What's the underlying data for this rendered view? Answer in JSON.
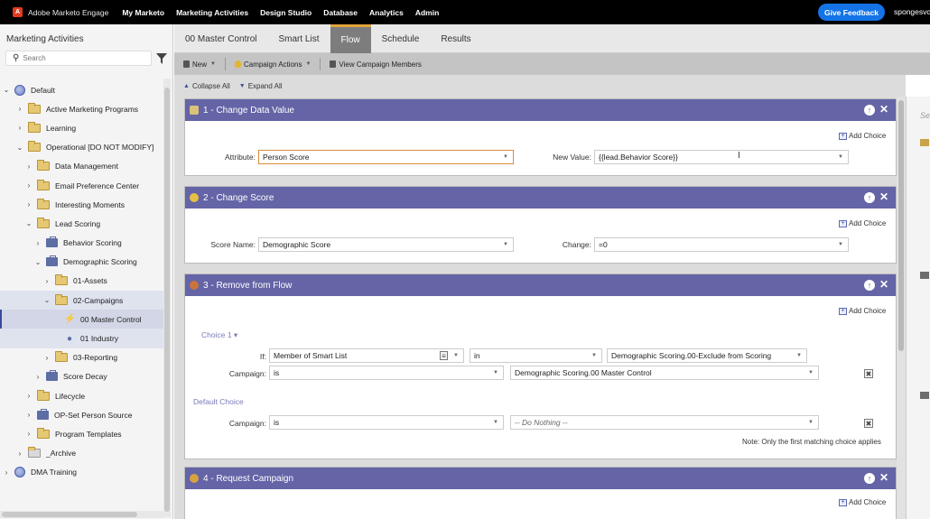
{
  "topnav": {
    "brand": "Adobe Marketo Engage",
    "items": [
      "My Marketo",
      "Marketing Activities",
      "Design Studio",
      "Database",
      "Analytics",
      "Admin"
    ],
    "feedback": "Give Feedback",
    "user": "spongesvc"
  },
  "leftpanel": {
    "title": "Marketing Activities",
    "search_placeholder": "Search",
    "tree": [
      {
        "label": "Default",
        "icon": "globe-icon",
        "chevron": "down",
        "depth": 0
      },
      {
        "label": "Active Marketing Programs",
        "icon": "folder-icon",
        "chevron": "right",
        "depth": 1
      },
      {
        "label": "Learning",
        "icon": "folder-icon",
        "chevron": "right",
        "depth": 1
      },
      {
        "label": "Operational [DO NOT MODIFY]",
        "icon": "folder-icon",
        "chevron": "down",
        "depth": 1
      },
      {
        "label": "Data Management",
        "icon": "folder-icon",
        "chevron": "right",
        "depth": 2
      },
      {
        "label": "Email Preference Center",
        "icon": "folder-icon",
        "chevron": "right",
        "depth": 2
      },
      {
        "label": "Interesting Moments",
        "icon": "folder-icon",
        "chevron": "right",
        "depth": 2
      },
      {
        "label": "Lead Scoring",
        "icon": "folder-icon",
        "chevron": "down",
        "depth": 2
      },
      {
        "label": "Behavior Scoring",
        "icon": "program-icon",
        "chevron": "right",
        "depth": 3
      },
      {
        "label": "Demographic Scoring",
        "icon": "program-icon",
        "chevron": "down",
        "depth": 3
      },
      {
        "label": "01-Assets",
        "icon": "folder-icon",
        "chevron": "right",
        "depth": 4
      },
      {
        "label": "02-Campaigns",
        "icon": "folder-icon",
        "chevron": "down",
        "depth": 4
      },
      {
        "label": "00 Master Control",
        "icon": "trigger-icon",
        "chevron": "",
        "depth": 5
      },
      {
        "label": "01 Industry",
        "icon": "batch-icon",
        "chevron": "",
        "depth": 5
      },
      {
        "label": "03-Reporting",
        "icon": "folder-icon",
        "chevron": "right",
        "depth": 4
      },
      {
        "label": "Score Decay",
        "icon": "program-icon",
        "chevron": "right",
        "depth": 3
      },
      {
        "label": "Lifecycle",
        "icon": "folder-icon",
        "chevron": "right",
        "depth": 2
      },
      {
        "label": "OP-Set Person Source",
        "icon": "program-icon",
        "chevron": "right",
        "depth": 2
      },
      {
        "label": "Program Templates",
        "icon": "folder-icon",
        "chevron": "right",
        "depth": 2
      },
      {
        "label": "_Archive",
        "icon": "archive-folder-icon",
        "chevron": "right",
        "depth": 1
      },
      {
        "label": "DMA Training",
        "icon": "globe-icon",
        "chevron": "right",
        "depth": 0
      }
    ]
  },
  "tabs": [
    "00 Master Control",
    "Smart List",
    "Flow",
    "Schedule",
    "Results"
  ],
  "active_tab": "Flow",
  "toolbar": {
    "new_label": "New",
    "campaign_actions_label": "Campaign Actions",
    "view_members_label": "View Campaign Members"
  },
  "collapsebar": {
    "collapse_label": "Collapse All",
    "expand_label": "Expand All"
  },
  "flow": {
    "add_choice": "Add Choice",
    "step1": {
      "title": "1 - Change Data Value",
      "attribute_label": "Attribute:",
      "attribute_value": "Person Score",
      "newvalue_label": "New Value:",
      "newvalue_value": "{{lead.Behavior Score}}"
    },
    "step2": {
      "title": "2 - Change Score",
      "scorename_label": "Score Name:",
      "scorename_value": "Demographic Score",
      "change_label": "Change:",
      "change_value": "=0"
    },
    "step3": {
      "title": "3 - Remove from Flow",
      "choice_label": "Choice 1 ▾",
      "if_label": "If:",
      "if_field": "Member of Smart List",
      "if_operator": "in",
      "if_value": "Demographic Scoring.00-Exclude from Scoring",
      "campaign_label": "Campaign:",
      "campaign_operator": "is",
      "campaign_value": "Demographic Scoring.00 Master Control",
      "default_choice_label": "Default Choice",
      "default_campaign_label": "Campaign:",
      "default_operator": "is",
      "default_value": "-- Do Nothing --",
      "note": "Note: Only the first matching choice applies"
    },
    "step4": {
      "title": "4 - Request Campaign"
    }
  },
  "rightpanel": {
    "text": "Se"
  }
}
